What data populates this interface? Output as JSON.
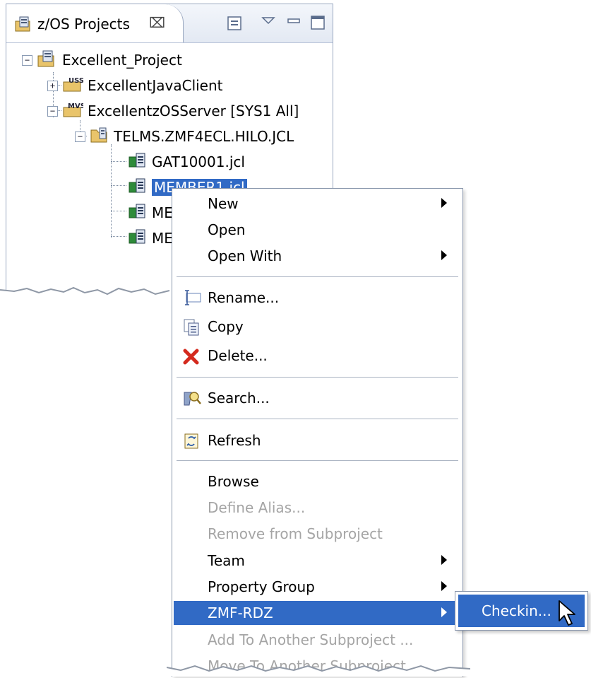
{
  "tab": {
    "title": "z/OS Projects",
    "close_symbol": "⌧",
    "icon": "zos-projects-icon"
  },
  "tree": {
    "project": {
      "label": "Excellent_Project"
    },
    "java_client": {
      "label": "ExcellentJavaClient",
      "badge": "USS"
    },
    "server": {
      "label": "ExcellentzOSServer  [SYS1 All]",
      "badge": "MVS"
    },
    "dataset": {
      "label": "TELMS.ZMF4ECL.HILO.JCL"
    },
    "members": [
      "GAT10001.jcl",
      "MEMBER1.jcl",
      "ME",
      "ME"
    ],
    "selected_index": 1
  },
  "context_menu": {
    "new": "New",
    "open": "Open",
    "open_with": "Open With",
    "rename": "Rename...",
    "copy": "Copy",
    "delete": "Delete...",
    "search": "Search...",
    "refresh": "Refresh",
    "browse": "Browse",
    "define_alias": "Define Alias...",
    "remove_from_subproject": "Remove from Subproject",
    "team": "Team",
    "property_group": "Property Group",
    "zmf_rdz": "ZMF-RDZ",
    "add_to_another": "Add To Another Subproject ...",
    "move_to_another": "Move To Another Subproject ..."
  },
  "submenu": {
    "checkin": "Checkin..."
  },
  "colors": {
    "selection": "#316ac5",
    "disabled_text": "#a5a5a5",
    "panel_border": "#9aa8c0"
  }
}
